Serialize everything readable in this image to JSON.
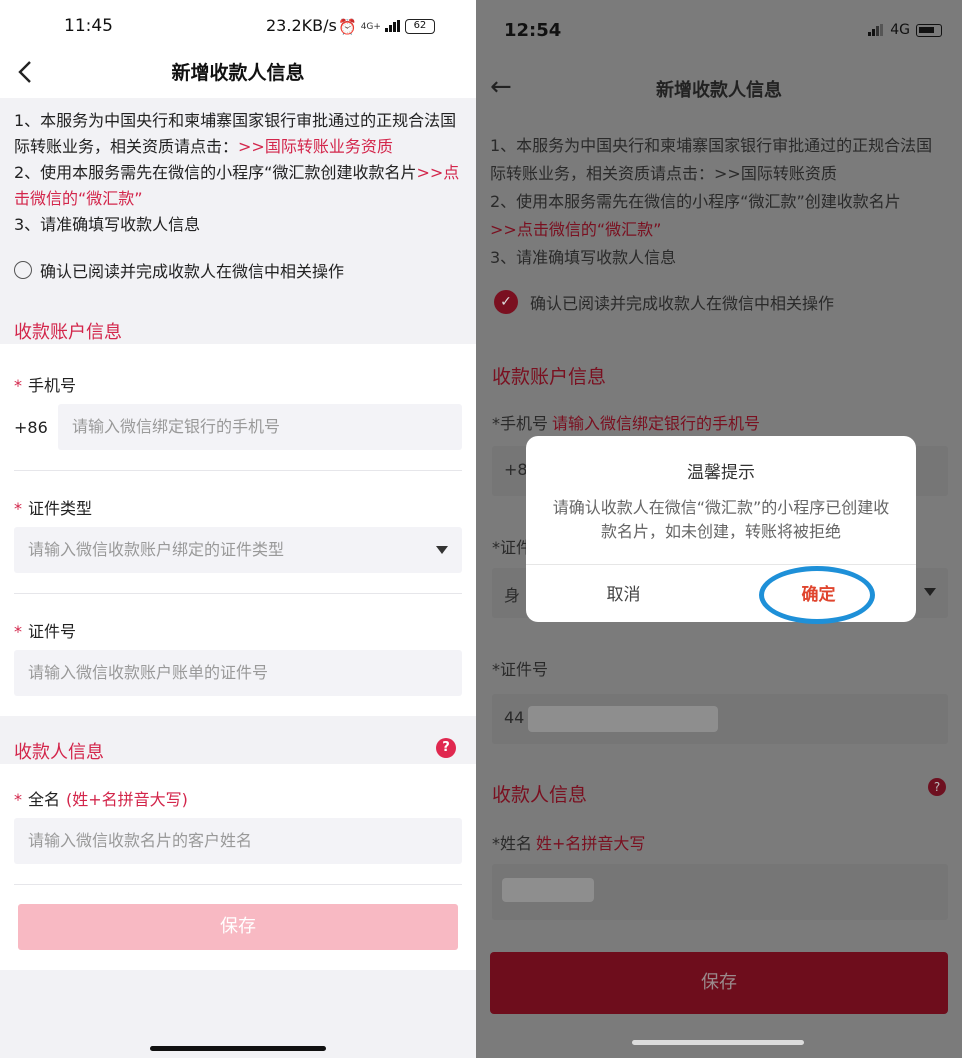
{
  "left": {
    "status_bar": {
      "time": "11:45",
      "network_speed": "23.2KB/s",
      "battery": "62",
      "signal_label": "4G+"
    },
    "nav": {
      "title": "新增收款人信息"
    },
    "notice": {
      "line1_a": "1、本服务为中国央行和柬埔寨国家银行审批通过的正规合法国际转账业务，相关资质请点击：",
      "line1_link": ">>国际转账业务资质",
      "line2_a": "2、使用本服务需先在微信的小程序“微汇款创建收款名片",
      "line2_link": ">>点击微信的“微汇款”",
      "line3": "3、请准确填写收款人信息"
    },
    "agree_label": "确认已阅读并完成收款人在微信中相关操作",
    "section_account": "收款账户信息",
    "phone": {
      "label": "手机号",
      "prefix": "+86",
      "placeholder": "请输入微信绑定银行的手机号"
    },
    "id_type": {
      "label": "证件类型",
      "placeholder": "请输入微信收款账户绑定的证件类型"
    },
    "id_number": {
      "label": "证件号",
      "placeholder": "请输入微信收款账户账单的证件号"
    },
    "section_payee": "收款人信息",
    "fullname": {
      "label": "全名",
      "hint": "(姓+名拼音大写)",
      "placeholder": "请输入微信收款名片的客户姓名"
    },
    "save_label": "保存",
    "star": "*",
    "help": "?"
  },
  "right": {
    "status_bar": {
      "time": "12:54",
      "network": "4G"
    },
    "nav": {
      "back": "←",
      "title": "新增收款人信息"
    },
    "notice": {
      "line1": "1、本服务为中国央行和柬埔寨国家银行审批通过的正规合法国际转账业务，相关资质请点击：>>国际转账资质",
      "line2_a": "2、使用本服务需先在微信的小程序“微汇款”创建收款名片",
      "line2_link": ">>点击微信的“微汇款”",
      "line3": "3、请准确填写收款人信息"
    },
    "agree_label": "确认已阅读并完成收款人在微信中相关操作",
    "section_account": "收款账户信息",
    "phone_label": "*手机号",
    "phone_hint": "请输入微信绑定银行的手机号",
    "phone_value": "+8",
    "id_type_label": "*证件",
    "id_type_value": "身",
    "id_number_label": "*证件号",
    "id_number_value": "44",
    "section_payee": "收款人信息",
    "name_label": "*姓名",
    "name_hint": "姓+名拼音大写",
    "save_label": "保存",
    "dialog": {
      "title": "温馨提示",
      "message": "请确认收款人在微信“微汇款”的小程序已创建收款名片，如未创建，转账将被拒绝",
      "cancel": "取消",
      "confirm": "确定"
    }
  },
  "colors": {
    "accent": "#d3264b",
    "ring": "#1e90d8",
    "confirm": "#e0452e"
  }
}
